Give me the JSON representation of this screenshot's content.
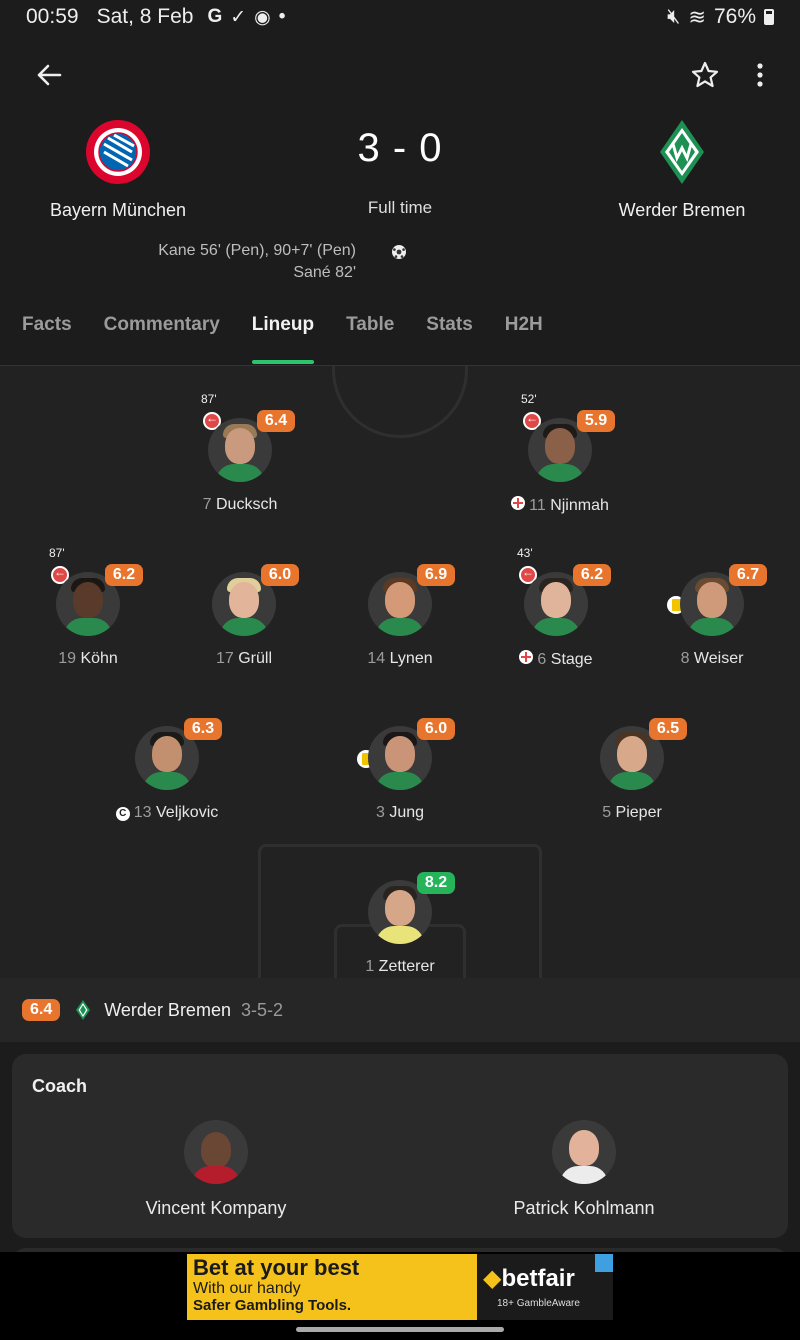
{
  "status_bar": {
    "time": "00:59",
    "date": "Sat, 8 Feb",
    "notification_icons": [
      "google-icon",
      "check-icon",
      "messenger-icon",
      "dot-icon"
    ],
    "battery": "76%"
  },
  "match": {
    "home_team": "Bayern München",
    "away_team": "Werder Bremen",
    "score": "3 - 0",
    "status": "Full time",
    "scorers": [
      "Kane 56' (Pen), 90+7' (Pen)",
      "Sané 82'"
    ]
  },
  "tabs": [
    {
      "label": "Facts"
    },
    {
      "label": "Commentary"
    },
    {
      "label": "Lineup",
      "active": true
    },
    {
      "label": "Table"
    },
    {
      "label": "Stats"
    },
    {
      "label": "H2H"
    }
  ],
  "lineup": {
    "forwards": [
      {
        "number": "7",
        "name": "Ducksch",
        "rating": "6.4",
        "sub_minute": "87'"
      },
      {
        "number": "11",
        "name": "Njinmah",
        "rating": "5.9",
        "sub_minute": "52'",
        "injured": true
      }
    ],
    "midfielders": [
      {
        "number": "19",
        "name": "Köhn",
        "rating": "6.2",
        "sub_minute": "87'"
      },
      {
        "number": "17",
        "name": "Grüll",
        "rating": "6.0"
      },
      {
        "number": "14",
        "name": "Lynen",
        "rating": "6.9"
      },
      {
        "number": "6",
        "name": "Stage",
        "rating": "6.2",
        "sub_minute": "43'",
        "injured": true
      },
      {
        "number": "8",
        "name": "Weiser",
        "rating": "6.7",
        "yellow_card": true
      }
    ],
    "defenders": [
      {
        "number": "13",
        "name": "Veljkovic",
        "rating": "6.3",
        "captain": "C"
      },
      {
        "number": "3",
        "name": "Jung",
        "rating": "6.0",
        "yellow_card": true
      },
      {
        "number": "5",
        "name": "Pieper",
        "rating": "6.5"
      }
    ],
    "goalkeeper": {
      "number": "1",
      "name": "Zetterer",
      "rating": "8.2"
    }
  },
  "team_bar": {
    "rating": "6.4",
    "team": "Werder Bremen",
    "formation": "3-5-2"
  },
  "coach": {
    "title": "Coach",
    "home": "Vincent Kompany",
    "away": "Patrick Kohlmann"
  },
  "ad": {
    "line1": "Bet at your best",
    "line2": "With our handy",
    "line3": "Safer Gambling Tools.",
    "brand": "betfair",
    "badge": "18+",
    "footer": "GambleAware"
  },
  "colors": {
    "rating_orange": "#e8752d",
    "rating_green": "#25b45a",
    "tab_indicator": "#2ec46e",
    "ad_yellow": "#f5c21b"
  }
}
